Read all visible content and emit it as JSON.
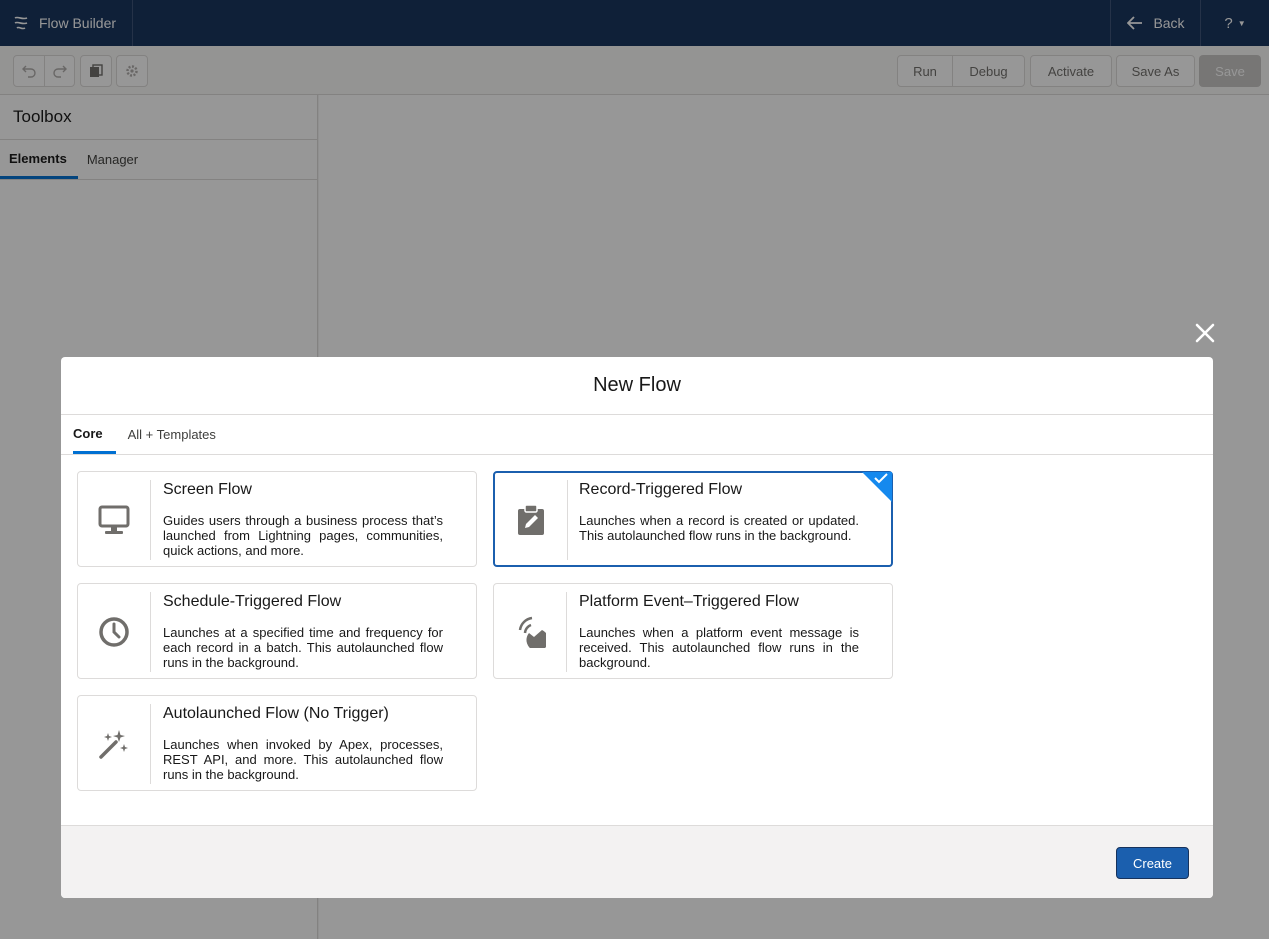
{
  "header": {
    "app_title": "Flow Builder",
    "back_label": "Back",
    "help_label": "?"
  },
  "toolbar": {
    "run": "Run",
    "debug": "Debug",
    "activate": "Activate",
    "save_as": "Save As",
    "save": "Save"
  },
  "sidebar": {
    "title": "Toolbox",
    "tabs": [
      {
        "label": "Elements",
        "active": true
      },
      {
        "label": "Manager",
        "active": false
      }
    ]
  },
  "modal": {
    "title": "New Flow",
    "tabs": [
      {
        "label": "Core",
        "active": true
      },
      {
        "label": "All + Templates",
        "active": false
      }
    ],
    "cards": [
      {
        "title": "Screen Flow",
        "description": "Guides users through a business process that’s launched from Lightning pages, communities, quick actions, and more.",
        "icon": "desktop-icon",
        "selected": false
      },
      {
        "title": "Record-Triggered Flow",
        "description": "Launches when a record is created or updated. This autolaunched flow runs in the background.",
        "icon": "clipboard-edit-icon",
        "selected": true
      },
      {
        "title": "Schedule-Triggered Flow",
        "description": "Launches at a specified time and frequency for each record in a batch. This autolaunched flow runs in the background.",
        "icon": "clock-icon",
        "selected": false
      },
      {
        "title": "Platform Event–Triggered Flow",
        "description": "Launches when a platform event message is received. This autolaunched flow runs in the background.",
        "icon": "broadcast-icon",
        "selected": false
      },
      {
        "title": "Autolaunched Flow (No Trigger)",
        "description": "Launches when invoked by Apex, processes, REST API, and more. This autolaunched flow runs in the background.",
        "icon": "magic-wand-icon",
        "selected": false
      }
    ],
    "create_label": "Create"
  },
  "colors": {
    "header_bg": "#16325c",
    "brand_blue": "#1b5fae",
    "tab_underline": "#0070d2",
    "checkmark_bg": "#1589ee"
  }
}
